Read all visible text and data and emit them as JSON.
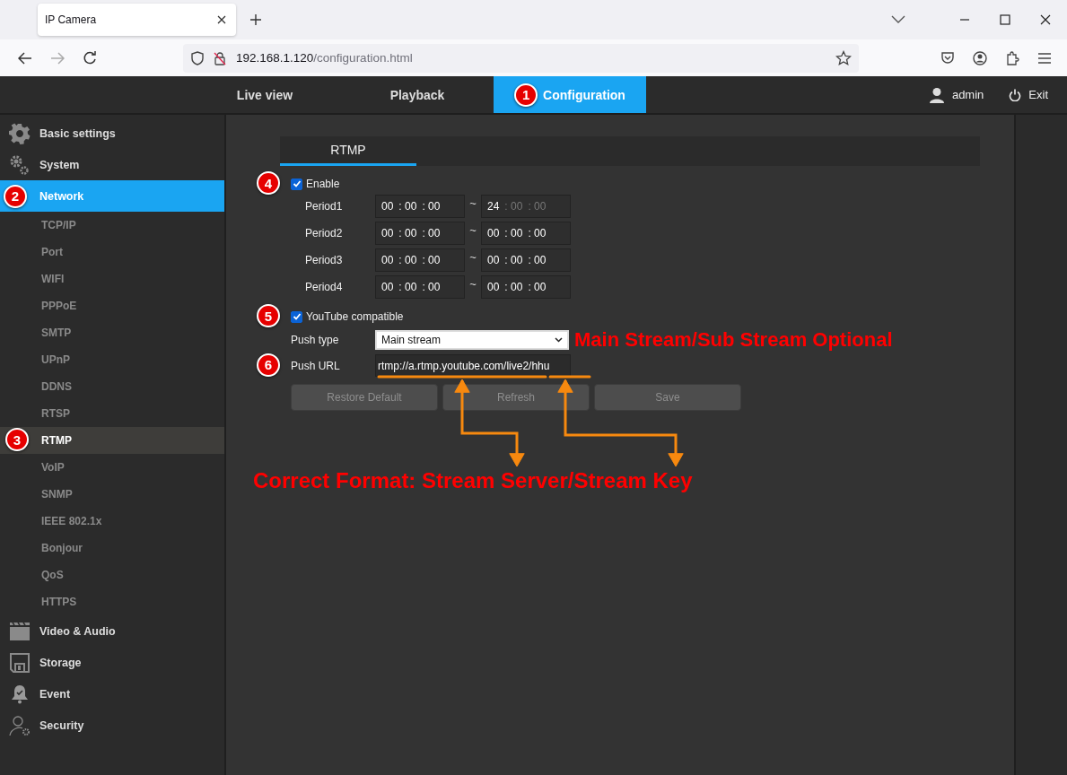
{
  "browser": {
    "tab_title": "IP Camera",
    "url_host": "192.168.1.120",
    "url_path": "/configuration.html"
  },
  "nav": {
    "items": [
      {
        "label": "Live view",
        "selected": false
      },
      {
        "label": "Playback",
        "selected": false
      },
      {
        "label": "Configuration",
        "selected": true,
        "badge": "1"
      }
    ],
    "user": "admin",
    "exit": "Exit"
  },
  "sidebar": {
    "items": [
      {
        "label": "Basic settings",
        "kind": "gear",
        "selected": false
      },
      {
        "label": "System",
        "kind": "gears",
        "selected": false
      },
      {
        "label": "Network",
        "selected": true,
        "badge": "2",
        "children": [
          {
            "label": "TCP/IP",
            "selected": false
          },
          {
            "label": "Port",
            "selected": false
          },
          {
            "label": "WIFI",
            "selected": false
          },
          {
            "label": "PPPoE",
            "selected": false
          },
          {
            "label": "SMTP",
            "selected": false
          },
          {
            "label": "UPnP",
            "selected": false
          },
          {
            "label": "DDNS",
            "selected": false
          },
          {
            "label": "RTSP",
            "selected": false
          },
          {
            "label": "RTMP",
            "selected": true,
            "badge": "3"
          },
          {
            "label": "VoIP",
            "selected": false
          },
          {
            "label": "SNMP",
            "selected": false
          },
          {
            "label": "IEEE 802.1x",
            "selected": false
          },
          {
            "label": "Bonjour",
            "selected": false
          },
          {
            "label": "QoS",
            "selected": false
          },
          {
            "label": "HTTPS",
            "selected": false
          }
        ]
      },
      {
        "label": "Video & Audio",
        "kind": "clapper",
        "selected": false
      },
      {
        "label": "Storage",
        "kind": "floppy",
        "selected": false
      },
      {
        "label": "Event",
        "kind": "bell",
        "selected": false
      },
      {
        "label": "Security",
        "kind": "usergear",
        "selected": false
      }
    ]
  },
  "tabs": [
    {
      "label": "RTMP",
      "selected": true
    }
  ],
  "form": {
    "enable": {
      "label": "Enable",
      "checked": true,
      "badge": "4"
    },
    "periods": [
      {
        "label": "Period1",
        "start": [
          {
            "text": "00",
            "disabled": false
          },
          {
            "text": ": 00",
            "disabled": false
          },
          {
            "text": ": 00",
            "disabled": false
          }
        ],
        "tilde": "~",
        "end": [
          {
            "text": "24",
            "disabled": false
          },
          {
            "text": ": 00",
            "disabled": true
          },
          {
            "text": ": 00",
            "disabled": true
          }
        ]
      },
      {
        "label": "Period2",
        "start": [
          {
            "text": "00",
            "disabled": false
          },
          {
            "text": ": 00",
            "disabled": false
          },
          {
            "text": ": 00",
            "disabled": false
          }
        ],
        "tilde": "~",
        "end": [
          {
            "text": "00",
            "disabled": false
          },
          {
            "text": ": 00",
            "disabled": false
          },
          {
            "text": ": 00",
            "disabled": false
          }
        ]
      },
      {
        "label": "Period3",
        "start": [
          {
            "text": "00",
            "disabled": false
          },
          {
            "text": ": 00",
            "disabled": false
          },
          {
            "text": ": 00",
            "disabled": false
          }
        ],
        "tilde": "~",
        "end": [
          {
            "text": "00",
            "disabled": false
          },
          {
            "text": ": 00",
            "disabled": false
          },
          {
            "text": ": 00",
            "disabled": false
          }
        ]
      },
      {
        "label": "Period4",
        "start": [
          {
            "text": "00",
            "disabled": false
          },
          {
            "text": ": 00",
            "disabled": false
          },
          {
            "text": ": 00",
            "disabled": false
          }
        ],
        "tilde": "~",
        "end": [
          {
            "text": "00",
            "disabled": false
          },
          {
            "text": ": 00",
            "disabled": false
          },
          {
            "text": ": 00",
            "disabled": false
          }
        ]
      }
    ],
    "youtube": {
      "label": "YouTube compatible",
      "checked": true,
      "badge": "5"
    },
    "push_type": {
      "label": "Push type",
      "value": "Main stream",
      "note": "Main Stream/Sub Stream Optional"
    },
    "push_url": {
      "label": "Push URL",
      "value": "rtmp://a.rtmp.youtube.com/live2/hhu",
      "badge": "6"
    },
    "buttons": [
      {
        "label": "Restore Default",
        "disabled": true
      },
      {
        "label": "Refresh",
        "disabled": true
      },
      {
        "label": "Save",
        "disabled": true
      }
    ],
    "format_note": "Correct Format: Stream Server/Stream Key"
  }
}
